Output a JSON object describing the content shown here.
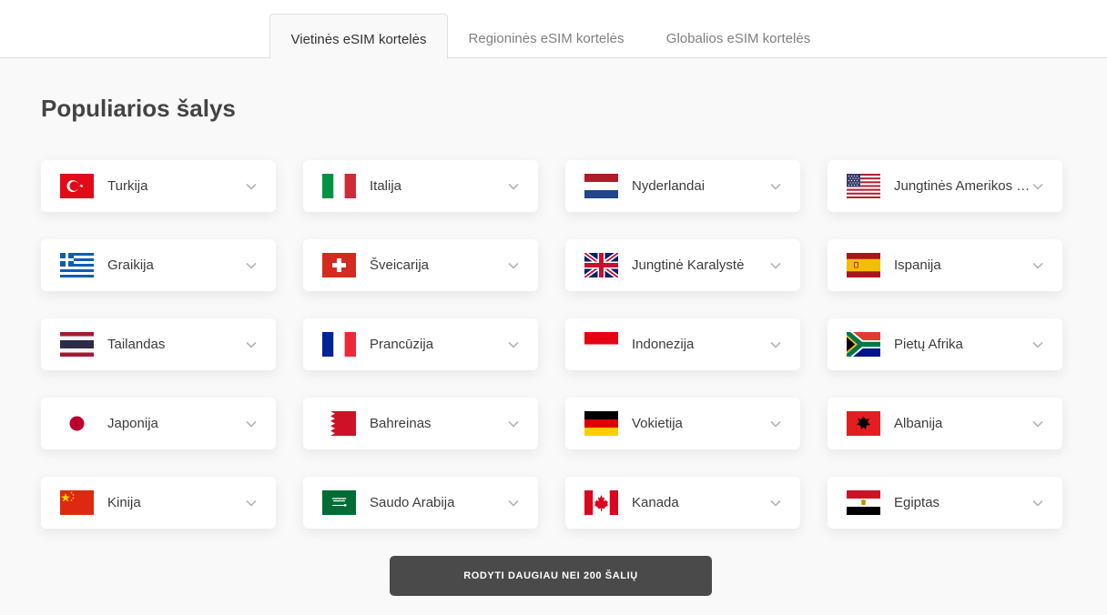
{
  "tabs": [
    {
      "label": "Vietinės eSIM kortelės"
    },
    {
      "label": "Regioninės eSIM kortelės"
    },
    {
      "label": "Globalios eSIM kortelės"
    }
  ],
  "section": {
    "title": "Populiarios šalys"
  },
  "countries": [
    {
      "name": "Turkija",
      "flag": "turkey-flag-icon"
    },
    {
      "name": "Italija",
      "flag": "italy-flag-icon"
    },
    {
      "name": "Nyderlandai",
      "flag": "netherlands-flag-icon"
    },
    {
      "name": "Jungtinės Amerikos Valstijos",
      "flag": "usa-flag-icon"
    },
    {
      "name": "Graikija",
      "flag": "greece-flag-icon"
    },
    {
      "name": "Šveicarija",
      "flag": "switzerland-flag-icon"
    },
    {
      "name": "Jungtinė Karalystė",
      "flag": "uk-flag-icon"
    },
    {
      "name": "Ispanija",
      "flag": "spain-flag-icon"
    },
    {
      "name": "Tailandas",
      "flag": "thailand-flag-icon"
    },
    {
      "name": "Prancūzija",
      "flag": "france-flag-icon"
    },
    {
      "name": "Indonezija",
      "flag": "indonesia-flag-icon"
    },
    {
      "name": "Pietų Afrika",
      "flag": "south-africa-flag-icon"
    },
    {
      "name": "Japonija",
      "flag": "japan-flag-icon"
    },
    {
      "name": "Bahreinas",
      "flag": "bahrain-flag-icon"
    },
    {
      "name": "Vokietija",
      "flag": "germany-flag-icon"
    },
    {
      "name": "Albanija",
      "flag": "albania-flag-icon"
    },
    {
      "name": "Kinija",
      "flag": "china-flag-icon"
    },
    {
      "name": "Saudo Arabija",
      "flag": "saudi-arabia-flag-icon"
    },
    {
      "name": "Kanada",
      "flag": "canada-flag-icon"
    },
    {
      "name": "Egiptas",
      "flag": "egypt-flag-icon"
    }
  ],
  "more_button": {
    "label": "RODYTI DAUGIAU NEI 200 ŠALIŲ"
  },
  "colors": {
    "button_bg": "#4a4a4a",
    "page_bg": "#f9f9f9",
    "card_bg": "#ffffff"
  }
}
